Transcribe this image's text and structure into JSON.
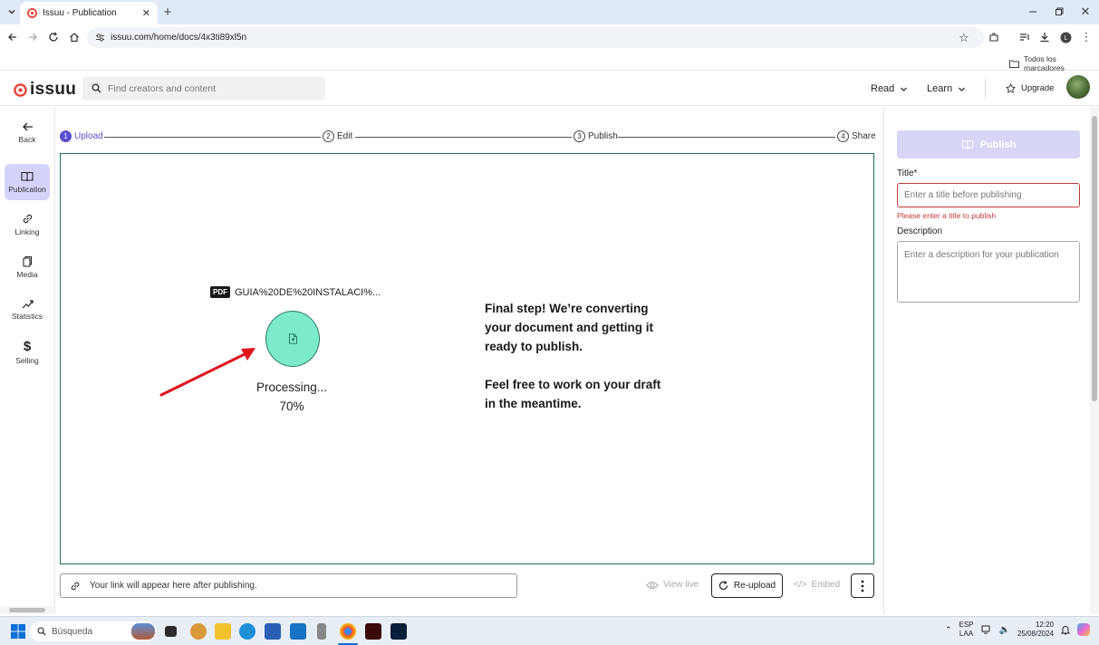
{
  "browser": {
    "tab_title": "Issuu - Publication",
    "url": "issuu.com/home/docs/4x3ti89xl5n",
    "bookmarks_label": "Todos los marcadores"
  },
  "header": {
    "logo": "issuu",
    "search_placeholder": "Find creators and content",
    "nav_read": "Read",
    "nav_learn": "Learn",
    "upgrade": "Upgrade"
  },
  "sidebar": {
    "items": [
      {
        "label": "Back",
        "icon": "arrow-left-icon"
      },
      {
        "label": "Publication",
        "icon": "book-icon"
      },
      {
        "label": "Linking",
        "icon": "link-icon"
      },
      {
        "label": "Media",
        "icon": "media-icon"
      },
      {
        "label": "Statistics",
        "icon": "chart-icon"
      },
      {
        "label": "Selling",
        "icon": "dollar-icon"
      }
    ]
  },
  "stepper": {
    "steps": [
      {
        "num": "1",
        "label": "Upload"
      },
      {
        "num": "2",
        "label": "Edit"
      },
      {
        "num": "3",
        "label": "Publish"
      },
      {
        "num": "4",
        "label": "Share"
      }
    ]
  },
  "upload": {
    "file_badge": "PDF",
    "file_name": "GUIA%20DE%20INSTALACI%...",
    "status": "Processing...",
    "progress_text": "70%",
    "progress": 0.7,
    "message_line1": "Final step! We’re converting your document and getting it ready to publish.",
    "message_line2": "Feel free to work on your draft in the meantime."
  },
  "bottom": {
    "link_placeholder": "Your link will appear here after publishing.",
    "view_live": "View live",
    "reupload": "Re-upload",
    "embed": "Embed"
  },
  "panel": {
    "publish_button": "Publish",
    "title_label": "Title*",
    "title_placeholder": "Enter a title before publishing",
    "title_error": "Please enter a title to publish",
    "description_label": "Description",
    "description_placeholder": "Enter a description for your publication"
  },
  "taskbar": {
    "search_placeholder": "Búsqueda",
    "lang1": "ESP",
    "lang2": "LAA",
    "time": "12:20",
    "date": "25/08/2024"
  },
  "colors": {
    "accent": "#5a4fcf",
    "brand": "#e8463a",
    "success_border": "#1e6e55",
    "progress_fill": "#7deacc",
    "error": "#c43b3b"
  }
}
